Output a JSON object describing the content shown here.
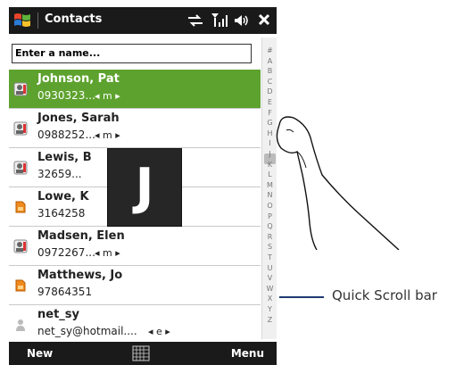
{
  "window": {
    "title": "Contacts"
  },
  "search": {
    "placeholder": "Enter a name..."
  },
  "contacts": [
    {
      "name": "Johnson, Pat",
      "detail": "0930323...",
      "kind": "◂ m ▸",
      "selected": true,
      "icon": "contact-card-icon"
    },
    {
      "name": "Jones, Sarah",
      "detail": "0988252...",
      "kind": "◂ m ▸",
      "selected": false,
      "icon": "contact-card-icon"
    },
    {
      "name": "Lewis, B",
      "detail": "32659...",
      "kind": "",
      "selected": false,
      "icon": "contact-card-icon"
    },
    {
      "name": "Lowe, K",
      "detail": "3164258",
      "kind": "",
      "selected": false,
      "icon": "sim-card-icon"
    },
    {
      "name": "Madsen, Elen",
      "detail": "0972267...",
      "kind": "◂ m ▸",
      "selected": false,
      "icon": "contact-card-icon"
    },
    {
      "name": "Matthews, Jo",
      "detail": "97864351",
      "kind": "",
      "selected": false,
      "icon": "sim-card-icon"
    },
    {
      "name": "net_sy",
      "detail": "net_sy@hotmail....",
      "kind": "◂ e ▸",
      "selected": false,
      "icon": "person-icon"
    }
  ],
  "quick_scroll": {
    "letters": [
      "#",
      "A",
      "B",
      "C",
      "D",
      "E",
      "F",
      "G",
      "H",
      "I",
      "J",
      "K",
      "L",
      "M",
      "N",
      "O",
      "P",
      "Q",
      "R",
      "S",
      "T",
      "U",
      "V",
      "W",
      "X",
      "Y",
      "Z"
    ],
    "current": "J"
  },
  "menu": {
    "left": "New",
    "right": "Menu"
  },
  "annotation": {
    "label": "Quick Scroll bar"
  },
  "colors": {
    "accent": "#5da22e",
    "bar": "#1a1a1a",
    "callout": "#1f3a74"
  }
}
